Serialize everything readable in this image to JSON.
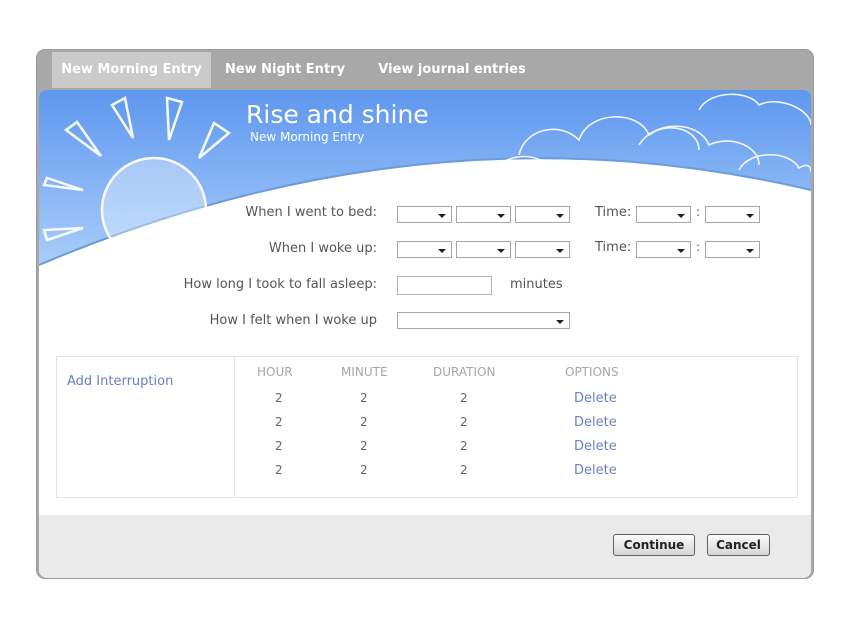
{
  "tabs": [
    {
      "label": "New Morning Entry",
      "active": true
    },
    {
      "label": "New Night Entry",
      "active": false
    },
    {
      "label": "View journal entries",
      "active": false
    }
  ],
  "hero": {
    "title": "Rise and shine",
    "subtitle": "New Morning Entry"
  },
  "form": {
    "bed_label": "When I went to bed:",
    "wake_label": "When I woke up:",
    "time_label": "Time:",
    "time_separator": ":",
    "asleep_label": "How long I took to fall asleep:",
    "asleep_value": "",
    "asleep_unit": "minutes",
    "felt_label": "How I felt when I woke up",
    "felt_value": ""
  },
  "interruptions": {
    "add_label": "Add Interruption",
    "headers": [
      "HOUR",
      "MINUTE",
      "DURATION",
      "OPTIONS"
    ],
    "rows": [
      {
        "hour": "2",
        "minute": "2",
        "duration": "2",
        "action": "Delete"
      },
      {
        "hour": "2",
        "minute": "2",
        "duration": "2",
        "action": "Delete"
      },
      {
        "hour": "2",
        "minute": "2",
        "duration": "2",
        "action": "Delete"
      },
      {
        "hour": "2",
        "minute": "2",
        "duration": "2",
        "action": "Delete"
      }
    ]
  },
  "footer": {
    "continue_label": "Continue",
    "cancel_label": "Cancel"
  },
  "colors": {
    "sky": "#7aaef5",
    "link": "#6a7fc4",
    "chrome": "#a8a8a8"
  }
}
